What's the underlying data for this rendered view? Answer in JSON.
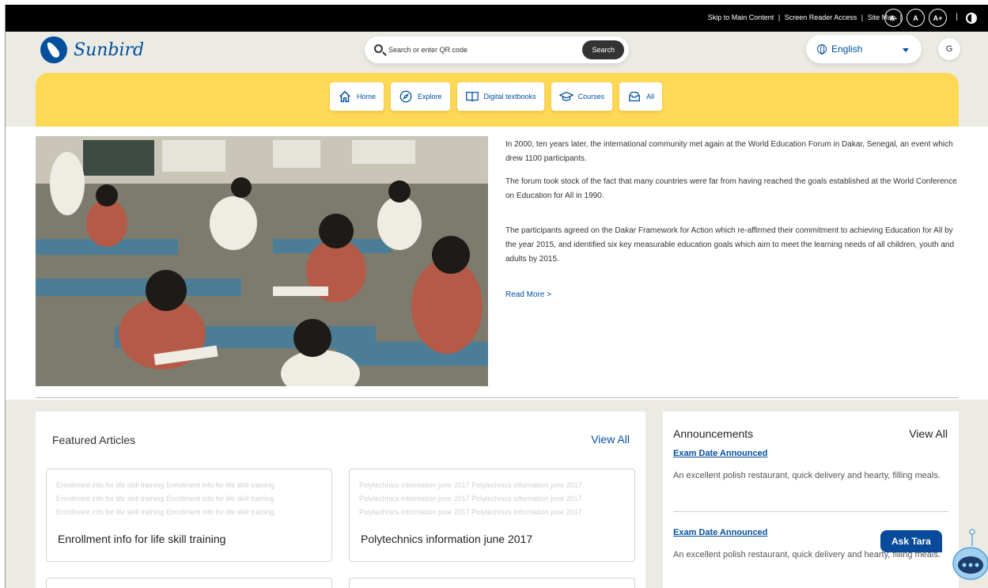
{
  "topbar": {
    "skip_link": "Skip to Main Content",
    "screen_reader": "Screen Reader Access",
    "site_map": "Site Map",
    "font_decrease": "A-",
    "font_normal": "A",
    "font_increase": "A+",
    "separator": "|"
  },
  "header": {
    "logo_text": "Sunbird",
    "search_placeholder": "Search or enter QR code",
    "search_button": "Search",
    "language": "English",
    "avatar_initial": "G"
  },
  "nav": {
    "items": [
      {
        "label": "Home",
        "icon": "home-icon"
      },
      {
        "label": "Explore",
        "icon": "compass-icon"
      },
      {
        "label": "Digital textbooks",
        "icon": "book-icon"
      },
      {
        "label": "Courses",
        "icon": "graduation-cap-icon"
      },
      {
        "label": "All",
        "icon": "inbox-icon"
      }
    ]
  },
  "hero": {
    "para1": "In 2000, ten years later, the international community met again at the World Education Forum in Dakar, Senegal, an event which drew 1100 participants.",
    "para2": "The forum took stock of the fact that many countries were far from having reached the goals established at the World Conference on Education for All in 1990.",
    "para3": "The participants agreed on the Dakar Framework for Action which re-affirmed their commitment to achieving Education for All by the year 2015, and identified six key measurable education goals which aim to meet the learning needs of all children, youth and adults by 2015.",
    "read_more": "Read More >"
  },
  "featured": {
    "title": "Featured Articles",
    "view_all": "View All",
    "cards": [
      {
        "faded": "Enrollment info for life skill training Enrollment info for life skill training",
        "title": "Enrollment info for life skill training"
      },
      {
        "faded": "Polytechnics information june 2017 Polytechnics information june 2017",
        "title": "Polytechnics information june 2017"
      }
    ]
  },
  "announcements": {
    "title": "Announcements",
    "view_all": "View All",
    "items": [
      {
        "link": "Exam Date Announced",
        "desc": "An excellent polish restaurant, quick delivery and hearty, filling meals."
      },
      {
        "link": "Exam Date Announced",
        "desc": "An excellent polish restaurant, quick delivery and hearty, filling meals."
      }
    ]
  },
  "chatbot": {
    "label": "Ask Tara"
  },
  "colors": {
    "brand_blue": "#024f9d",
    "nav_yellow": "#ffd855",
    "topbar_black": "#000000"
  }
}
